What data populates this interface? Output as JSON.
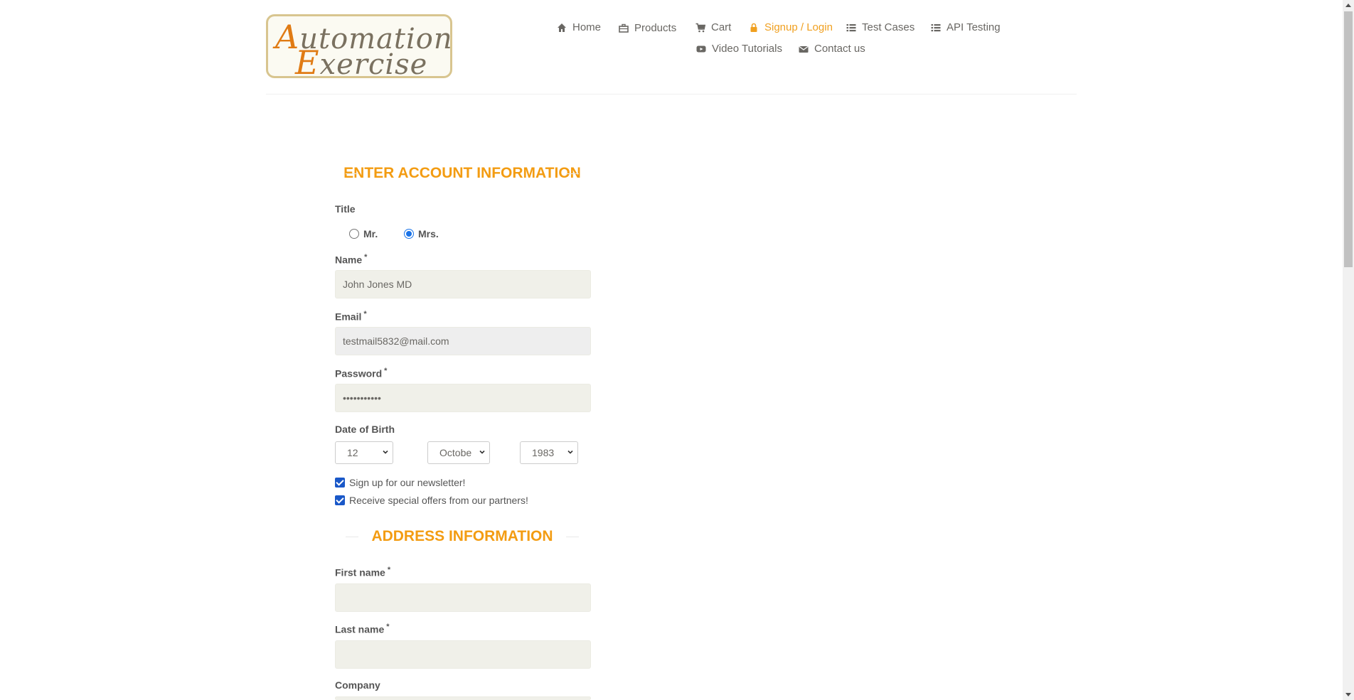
{
  "logo": {
    "line1": "Automation",
    "line2": "Exercise"
  },
  "nav": {
    "home": "Home",
    "products": "Products",
    "cart": "Cart",
    "signup_login": "Signup / Login",
    "test_cases": "Test Cases",
    "api_testing": "API Testing",
    "video_tutorials": "Video Tutorials",
    "contact_us": "Contact us"
  },
  "account": {
    "heading": "ENTER ACCOUNT INFORMATION",
    "title_label": "Title",
    "title_options": [
      "Mr.",
      "Mrs."
    ],
    "title_selected": "Mrs.",
    "name_label": "Name",
    "name_value": "John Jones MD",
    "email_label": "Email",
    "email_value": "testmail5832@mail.com",
    "password_label": "Password",
    "password_value": "•••••••••••",
    "dob_label": "Date of Birth",
    "dob_day": "12",
    "dob_month": "Octobe",
    "dob_year": "1983",
    "newsletter_label": "Sign up for our newsletter!",
    "offers_label": "Receive special offers from our partners!",
    "required_mark": "*"
  },
  "address": {
    "heading": "ADDRESS INFORMATION",
    "first_name_label": "First name",
    "first_name_value": "",
    "last_name_label": "Last name",
    "last_name_value": "",
    "company_label": "Company"
  },
  "colors": {
    "accent": "#f39c12",
    "field_bg": "#f0f0e9",
    "checkbox": "#1a58c8",
    "radio": "#1a73e8"
  }
}
